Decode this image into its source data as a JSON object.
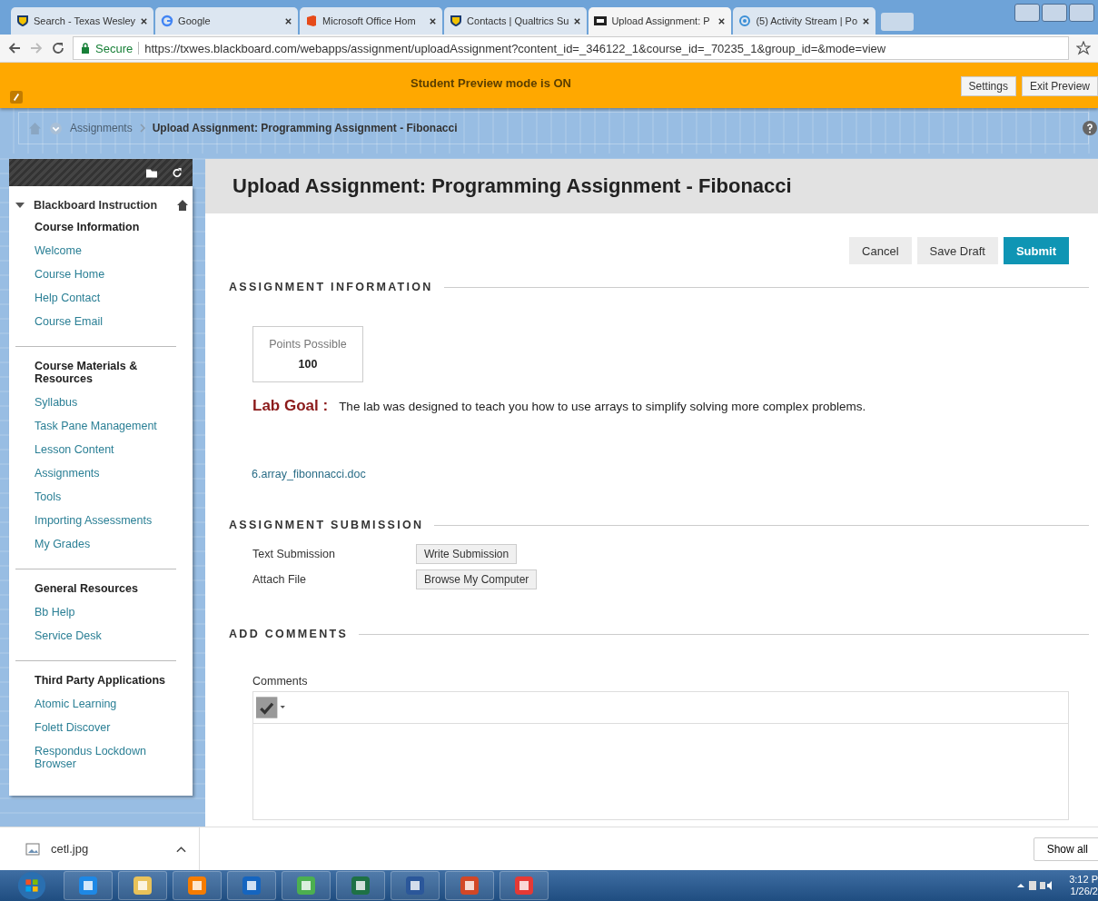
{
  "browser": {
    "tabs": [
      {
        "title": "Search - Texas Wesley",
        "selected": false
      },
      {
        "title": "Google",
        "selected": false
      },
      {
        "title": "Microsoft Office Hom",
        "selected": false
      },
      {
        "title": "Contacts | Qualtrics Su",
        "selected": false
      },
      {
        "title": "Upload Assignment: P",
        "selected": true
      },
      {
        "title": "(5) Activity Stream | Po",
        "selected": false
      }
    ],
    "secure_label": "Secure",
    "url": "https://txwes.blackboard.com/webapps/assignment/uploadAssignment?content_id=_346122_1&course_id=_70235_1&group_id=&mode=view"
  },
  "preview_banner": {
    "message": "Student Preview mode is ON",
    "buttons": [
      "Settings",
      "Exit Preview"
    ]
  },
  "breadcrumb": {
    "items": [
      "Assignments",
      "Upload Assignment: Programming Assignment - Fibonacci"
    ]
  },
  "sidebar": {
    "course_title": "Blackboard Instruction",
    "sections": [
      {
        "title": "Course Information",
        "items": [
          "Welcome",
          "Course Home",
          "Help Contact",
          "Course Email"
        ]
      },
      {
        "title": "Course Materials & Resources",
        "items": [
          "Syllabus",
          "Task Pane Management",
          "Lesson Content",
          "Assignments",
          "Tools",
          "Importing Assessments",
          "My Grades"
        ]
      },
      {
        "title": "General Resources",
        "items": [
          "Bb Help",
          "Service Desk"
        ]
      },
      {
        "title": "Third Party Applications",
        "items": [
          "Atomic Learning",
          "Folett Discover",
          "Respondus Lockdown Browser"
        ]
      }
    ]
  },
  "page": {
    "title": "Upload Assignment: Programming Assignment - Fibonacci",
    "actions": [
      {
        "label": "Cancel",
        "kind": "plain"
      },
      {
        "label": "Save Draft",
        "kind": "plain"
      },
      {
        "label": "Submit",
        "kind": "primary"
      }
    ],
    "info_heading": "ASSIGNMENT INFORMATION",
    "points": {
      "label": "Points Possible",
      "value": "100"
    },
    "lab_goal": {
      "label": "Lab Goal :",
      "text": "The lab was designed to teach you how to use arrays to simplify solving more complex problems."
    },
    "attachment": "6.array_fibonnacci.doc",
    "submission_heading": "ASSIGNMENT SUBMISSION",
    "submission_rows": [
      {
        "label": "Text Submission",
        "button": "Write Submission"
      },
      {
        "label": "Attach File",
        "button": "Browse My Computer"
      }
    ],
    "comments_heading": "ADD COMMENTS",
    "comments_label": "Comments"
  },
  "downloads": {
    "file": "cetl.jpg",
    "show_all": "Show all"
  },
  "taskbar": {
    "time": "3:12 P",
    "date": "1/26/2"
  }
}
